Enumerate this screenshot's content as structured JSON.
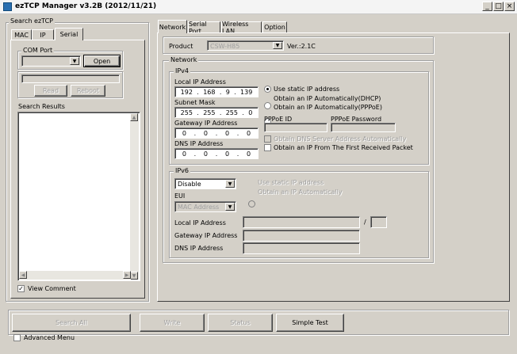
{
  "window": {
    "title": "ezTCP Manager v3.2B (2012/11/21)",
    "minimize": "_",
    "maximize": "□",
    "close": "×"
  },
  "search": {
    "group_label": "Search ezTCP",
    "tabs": [
      "MAC",
      "IP",
      "Serial"
    ],
    "com_port": {
      "label": "COM Port",
      "value": "",
      "open_label": "Open"
    },
    "status_value": "",
    "read_label": "Read",
    "reboot_label": "Reboot",
    "results_label": "Search Results",
    "view_comment_label": "View Comment",
    "view_comment_checked": true
  },
  "main_tabs": [
    "Network",
    "Serial Port",
    "Wireless LAN",
    "Option"
  ],
  "product": {
    "label": "Product",
    "value": "CSW-H85",
    "version": "Ver.:2.1C"
  },
  "network": {
    "group_label": "Network",
    "ipv4": {
      "label": "IPv4",
      "local_ip_label": "Local IP Address",
      "local_ip": [
        "192",
        "168",
        "9",
        "139"
      ],
      "subnet_label": "Subnet Mask",
      "subnet": [
        "255",
        "255",
        "255",
        "0"
      ],
      "gateway_label": "Gateway IP Address",
      "gateway": [
        "0",
        "0",
        "0",
        "0"
      ],
      "dns_label": "DNS IP Address",
      "dns": [
        "0",
        "0",
        "0",
        "0"
      ],
      "opt_static": "Use static IP address",
      "opt_dhcp": "Obtain an IP Automatically(DHCP)",
      "opt_pppoe": "Obtain an IP Automatically(PPPoE)",
      "pppoe_id_label": "PPPoE ID",
      "pppoe_password_label": "PPPoE Password",
      "obtain_dns_label": "Obtain DNS Server Address Automatically",
      "first_packet_label": "Obtain an IP From The First Received Packet"
    },
    "ipv6": {
      "label": "IPv6",
      "mode_value": "Disable",
      "opt_static": "Use static IP address",
      "opt_auto": "Obtain an IP Automatically",
      "eui_label": "EUI",
      "eui_value": "MAC Address",
      "local_ip_label": "Local IP Address",
      "prefix_sep": "/",
      "gateway_label": "Gateway IP Address",
      "dns_label": "DNS IP Address"
    }
  },
  "bottom": {
    "search_all": "Search All",
    "write": "Write",
    "status": "Status",
    "simple_test": "Simple Test",
    "advanced_menu_label": "Advanced Menu"
  },
  "ip_separator": "."
}
